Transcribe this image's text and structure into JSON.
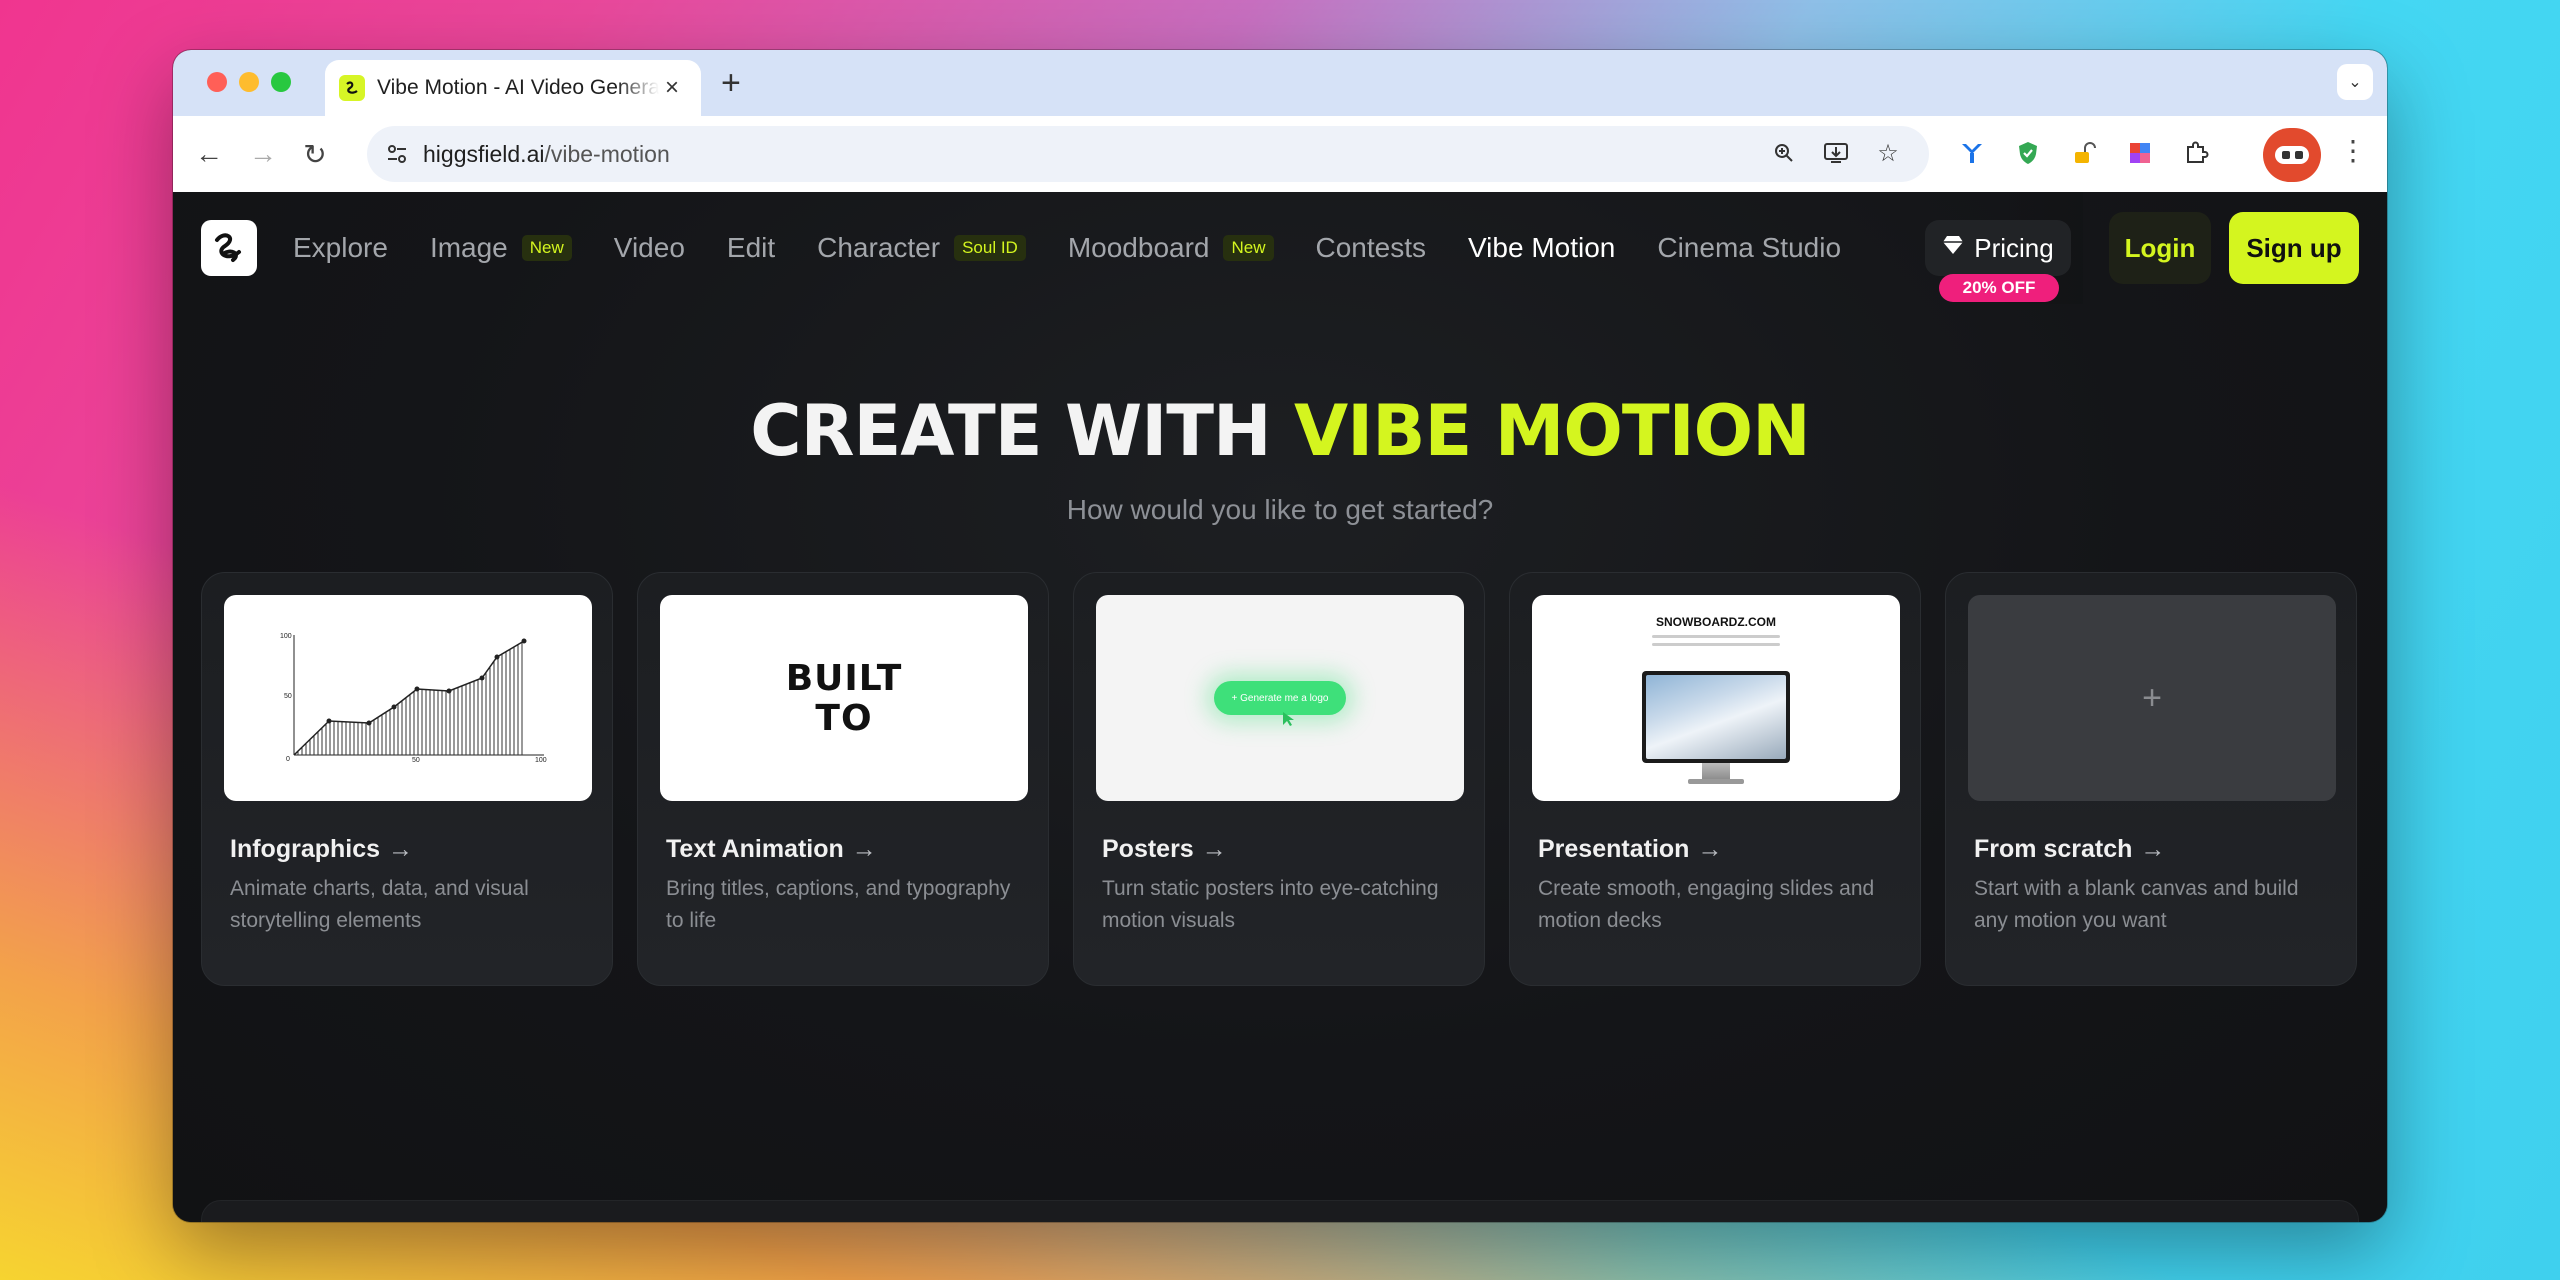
{
  "browser": {
    "tab_title": "Vibe Motion - AI Video Generator",
    "tab_favicon": "𝒮",
    "url_domain": "higgsfield.ai",
    "url_path": "/vibe-motion",
    "icons": [
      "back-icon",
      "forward-icon",
      "reload-icon",
      "site-info-icon",
      "zoom-icon",
      "install-icon",
      "bookmark-star-icon"
    ],
    "extensions": [
      "ext-y-icon",
      "ext-shield-icon",
      "ext-lock-icon",
      "ext-color-icon",
      "extensions-puzzle-icon"
    ]
  },
  "nav": {
    "items": [
      {
        "label": "Explore",
        "badge": ""
      },
      {
        "label": "Image",
        "badge": "New"
      },
      {
        "label": "Video",
        "badge": ""
      },
      {
        "label": "Edit",
        "badge": ""
      },
      {
        "label": "Character",
        "badge": "Soul ID"
      },
      {
        "label": "Moodboard",
        "badge": "New"
      },
      {
        "label": "Contests",
        "badge": ""
      },
      {
        "label": "Vibe Motion",
        "badge": "",
        "active": true
      },
      {
        "label": "Cinema Studio",
        "badge": ""
      }
    ],
    "pricing_label": "Pricing",
    "discount_label": "20% OFF",
    "login_label": "Login",
    "signup_label": "Sign up"
  },
  "hero": {
    "title_prefix": "CREATE WITH",
    "title_accent": "VIBE MOTION",
    "subtitle": "How would you like to get started?"
  },
  "cards": [
    {
      "title": "Infographics",
      "description": "Animate charts, data, and visual storytelling elements"
    },
    {
      "title": "Text Animation",
      "description": "Bring titles, captions, and typography to life"
    },
    {
      "title": "Posters",
      "description": "Turn static posters into eye-catching motion visuals"
    },
    {
      "title": "Presentation",
      "description": "Create smooth, engaging slides and motion decks"
    },
    {
      "title": "From scratch",
      "description": "Start with a blank canvas and build any motion you want"
    }
  ],
  "thumbnails": {
    "infographic_ticks_y": [
      "100",
      "50",
      "0"
    ],
    "infographic_ticks_x": [
      "50",
      "100"
    ],
    "built_text_line1": "BUILT",
    "built_text_line2": "TO",
    "poster_button": "+ Generate me a logo",
    "presentation_heading": "SNOWBOARDZ.COM"
  },
  "colors": {
    "accent": "#d4f51f",
    "discount": "#ef1f7c",
    "background": "#111214"
  }
}
